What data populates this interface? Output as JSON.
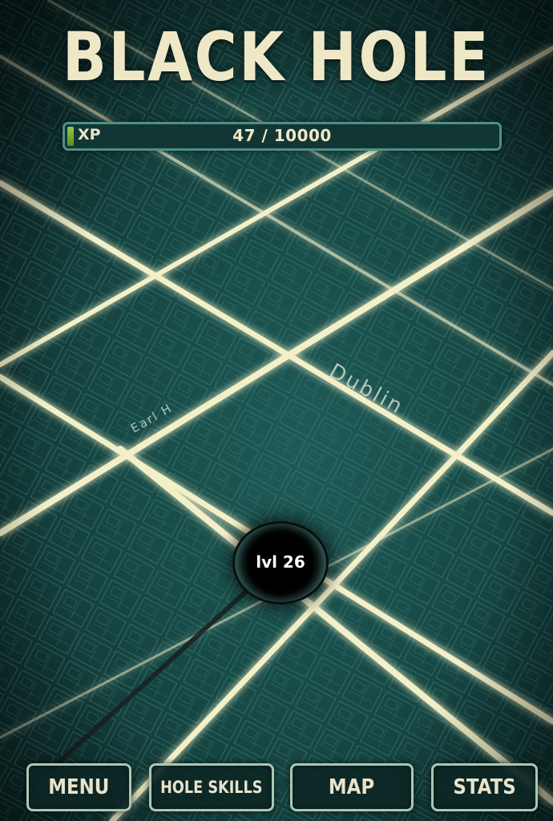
{
  "title": "BLACK HOLE",
  "xp": {
    "label": "XP",
    "current": 47,
    "max": 10000,
    "display": "47 / 10000",
    "fill_fraction": 0.0047
  },
  "player": {
    "level_label": "lvl 26"
  },
  "map": {
    "street_labels": [
      "Dublin",
      "Earl H"
    ]
  },
  "nav": {
    "menu": "MENU",
    "hole_skills": "HOLE SKILLS",
    "map": "MAP",
    "stats": "STATS"
  },
  "colors": {
    "background": "#174845",
    "road_glow": "#f3f0c8",
    "title_text": "#efe8c6",
    "xp_fill": "#7fa83a",
    "button_border": "#a8c8b6"
  }
}
